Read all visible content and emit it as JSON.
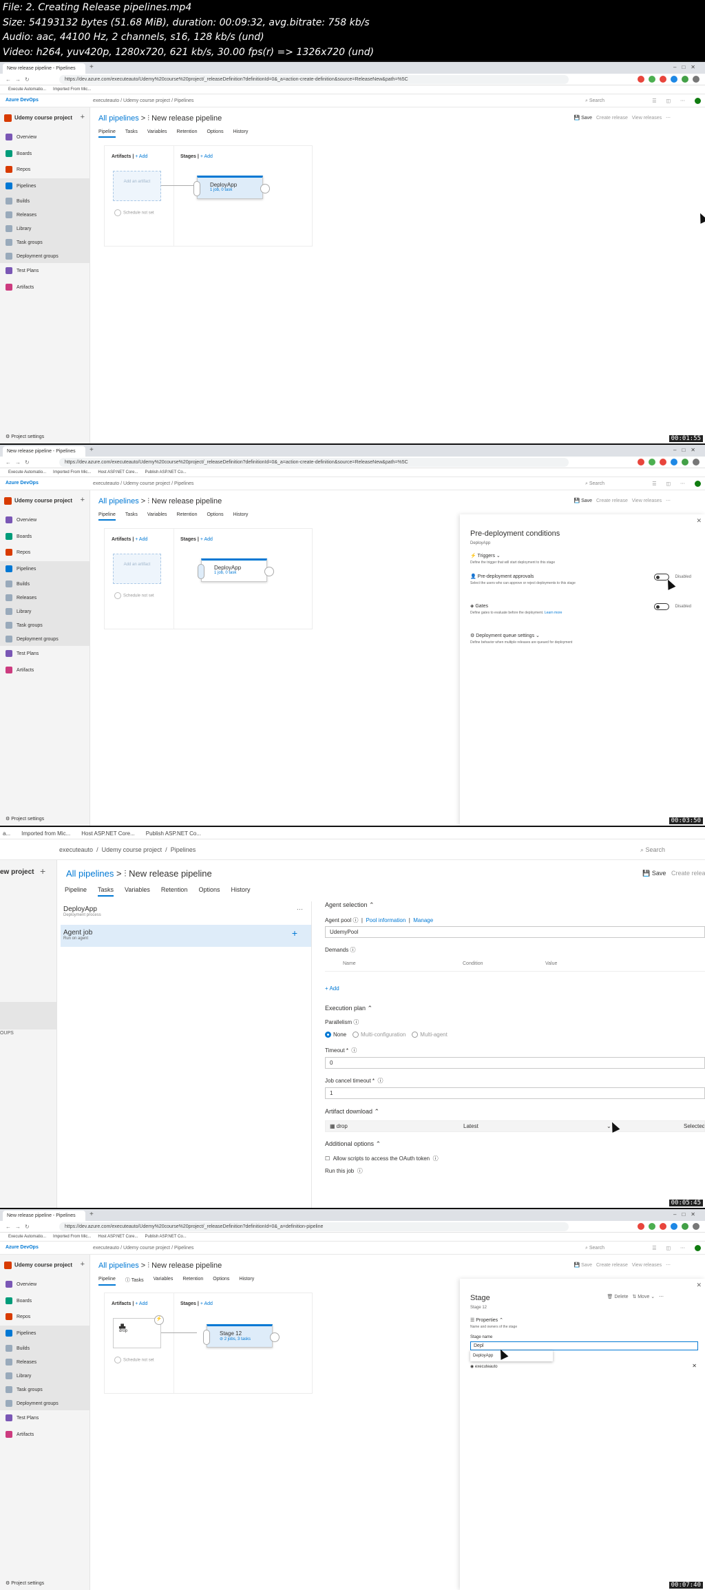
{
  "header": {
    "lines": [
      "File: 2. Creating Release pipelines.mp4",
      "Size: 54193132 bytes (51.68 MiB), duration: 00:09:32, avg.bitrate: 758 kb/s",
      "Audio: aac, 44100 Hz, 2 channels, s16, 128 kb/s (und)",
      "Video: h264, yuv420p, 1280x720, 621 kb/s, 30.00 fps(r) => 1326x720 (und)"
    ]
  },
  "browser": {
    "tab": "New release pipeline - Pipelines",
    "url": "https://dev.azure.com/executeauto/Udemy%20course%20project/_releaseDefinition?definitionId=0&_a=action-create-definition&source=ReleaseNew&path=%5C",
    "url4": "https://dev.azure.com/executeauto/Udemy%20course%20project/_releaseDefinition?definitionId=0&_a=definition-pipeline",
    "bookmarks": [
      "Execute Automatio...",
      "Imported From Mic...",
      "Host ASP.NET Core...",
      "Publish ASP.NET Co..."
    ]
  },
  "app": {
    "logo": "Azure DevOps",
    "crumbs": [
      "executeauto",
      "/",
      "Udemy course project",
      "/",
      "Pipelines"
    ],
    "search": "Search",
    "project": "Udemy course project",
    "settings": "Project settings"
  },
  "nav": [
    {
      "label": "Overview",
      "color": "#7a57b5"
    },
    {
      "label": "Boards",
      "color": "#009c7a"
    },
    {
      "label": "Repos",
      "color": "#d83b01"
    },
    {
      "label": "Pipelines",
      "color": "#0078d4"
    },
    {
      "label": "Builds",
      "color": "#a0a0a0",
      "sub": true
    },
    {
      "label": "Releases",
      "color": "#a0a0a0",
      "sub": true
    },
    {
      "label": "Library",
      "color": "#a0a0a0",
      "sub": true
    },
    {
      "label": "Task groups",
      "color": "#a0a0a0",
      "sub": true
    },
    {
      "label": "Deployment groups",
      "color": "#a0a0a0",
      "sub": true
    },
    {
      "label": "Test Plans",
      "color": "#7a57b5"
    },
    {
      "label": "Artifacts",
      "color": "#cc3b7f"
    }
  ],
  "pipeline": {
    "all": "All pipelines",
    "sep": ">",
    "title": "New release pipeline",
    "save": "Save",
    "create": "Create release",
    "view": "View releases",
    "tabs": [
      "Pipeline",
      "Tasks",
      "Variables",
      "Retention",
      "Options",
      "History"
    ],
    "artifacts": "Artifacts",
    "stages": "Stages",
    "add": "+ Add",
    "add_artifact": "Add an artifact",
    "schedule": "Schedule not set",
    "stage_name": "DeployApp",
    "stage_sub": "1 job, 0 task",
    "drop": "drop",
    "stage12": "Stage 12",
    "stage12_sub": "2 jobs, 3 tasks"
  },
  "pre": {
    "title": "Pre-deployment conditions",
    "sub": "DeployApp",
    "triggers": "Triggers",
    "triggers_d": "Define the trigger that will start deployment to this stage",
    "approvals": "Pre-deployment approvals",
    "approvals_d": "Select the users who can approve or reject deployments to this stage",
    "disabled": "Disabled",
    "gates": "Gates",
    "gates_d": "Define gates to evaluate before the deployment.",
    "learn": "Learn more",
    "queue": "Deployment queue settings",
    "queue_d": "Define behavior when multiple releases are queued for deployment"
  },
  "tasks": {
    "crumbs": [
      "executeauto",
      "/",
      "Udemy course project",
      "/",
      "Pipelines"
    ],
    "proj": "ew project",
    "deploy": "DeployApp",
    "deploy_sub": "Deployment process",
    "agent": "Agent job",
    "agent_sub": "Run on agent",
    "agent_sel": "Agent selection",
    "pool": "Agent pool",
    "pool_info": "Pool information",
    "manage": "Manage",
    "pool_val": "UdemyPool",
    "demands": "Demands",
    "name": "Name",
    "condition": "Condition",
    "value": "Value",
    "add": "+ Add",
    "exec": "Execution plan",
    "parallel": "Parallelism",
    "none": "None",
    "multicfg": "Multi-configuration",
    "multiagent": "Multi-agent",
    "timeout": "Timeout *",
    "timeout_v": "0",
    "cancel": "Job cancel timeout *",
    "cancel_v": "1",
    "artdl": "Artifact download",
    "drop": "drop",
    "latest": "Latest",
    "selected": "Selected a",
    "addl": "Additional options",
    "oauth": "Allow scripts to access the OAuth token",
    "run": "Run this job",
    "imported": "Imported from Mic...",
    "host": "Host ASP.NET Core...",
    "publish": "Publish ASP.NET Co...",
    "dgroups": "OUPS"
  },
  "stagepanel": {
    "title": "Stage",
    "sub": "Stage 12",
    "delete": "Delete",
    "move": "Move",
    "props": "Properties",
    "props_d": "Name and owners of the stage",
    "name_lbl": "Stage name",
    "name_val": "Depl",
    "suggest": "DeployApp",
    "owner": "executeauto"
  },
  "timestamps": [
    "00:01:55",
    "00:03:50",
    "00:05:45",
    "00:07:40"
  ]
}
